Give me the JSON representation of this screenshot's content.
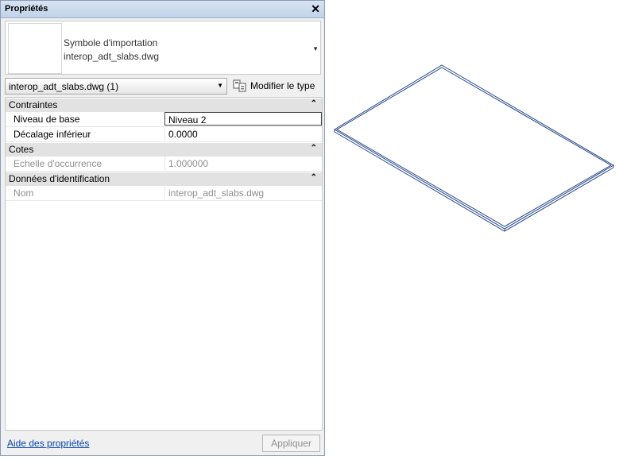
{
  "panel": {
    "title": "Propriétés",
    "close_glyph": "✕",
    "type_selector": {
      "category": "Symbole d'importation",
      "name": "interop_adt_slabs.dwg",
      "dropdown_glyph": "▼"
    },
    "instance_selector": {
      "value": "interop_adt_slabs.dwg (1)",
      "dropdown_glyph": "▼"
    },
    "edit_type_label": "Modifier le type",
    "groups": [
      {
        "label": "Contraintes",
        "collapse_glyph": "⌃",
        "rows": [
          {
            "name": "Niveau de base",
            "value": "Niveau 2"
          },
          {
            "name": "Décalage inférieur",
            "value": "0.0000"
          }
        ]
      },
      {
        "label": "Cotes",
        "collapse_glyph": "⌃",
        "rows": [
          {
            "name": "Echelle d'occurrence",
            "value": "1.000000"
          }
        ]
      },
      {
        "label": "Données d'identification",
        "collapse_glyph": "⌃",
        "rows": [
          {
            "name": "Nom",
            "value": "interop_adt_slabs.dwg"
          }
        ]
      }
    ],
    "help_link": "Aide des propriétés",
    "apply_label": "Appliquer"
  },
  "colors": {
    "titlebar": "#c9d9ee",
    "slab_outline": "#2a4b8c",
    "link": "#0645ad"
  }
}
